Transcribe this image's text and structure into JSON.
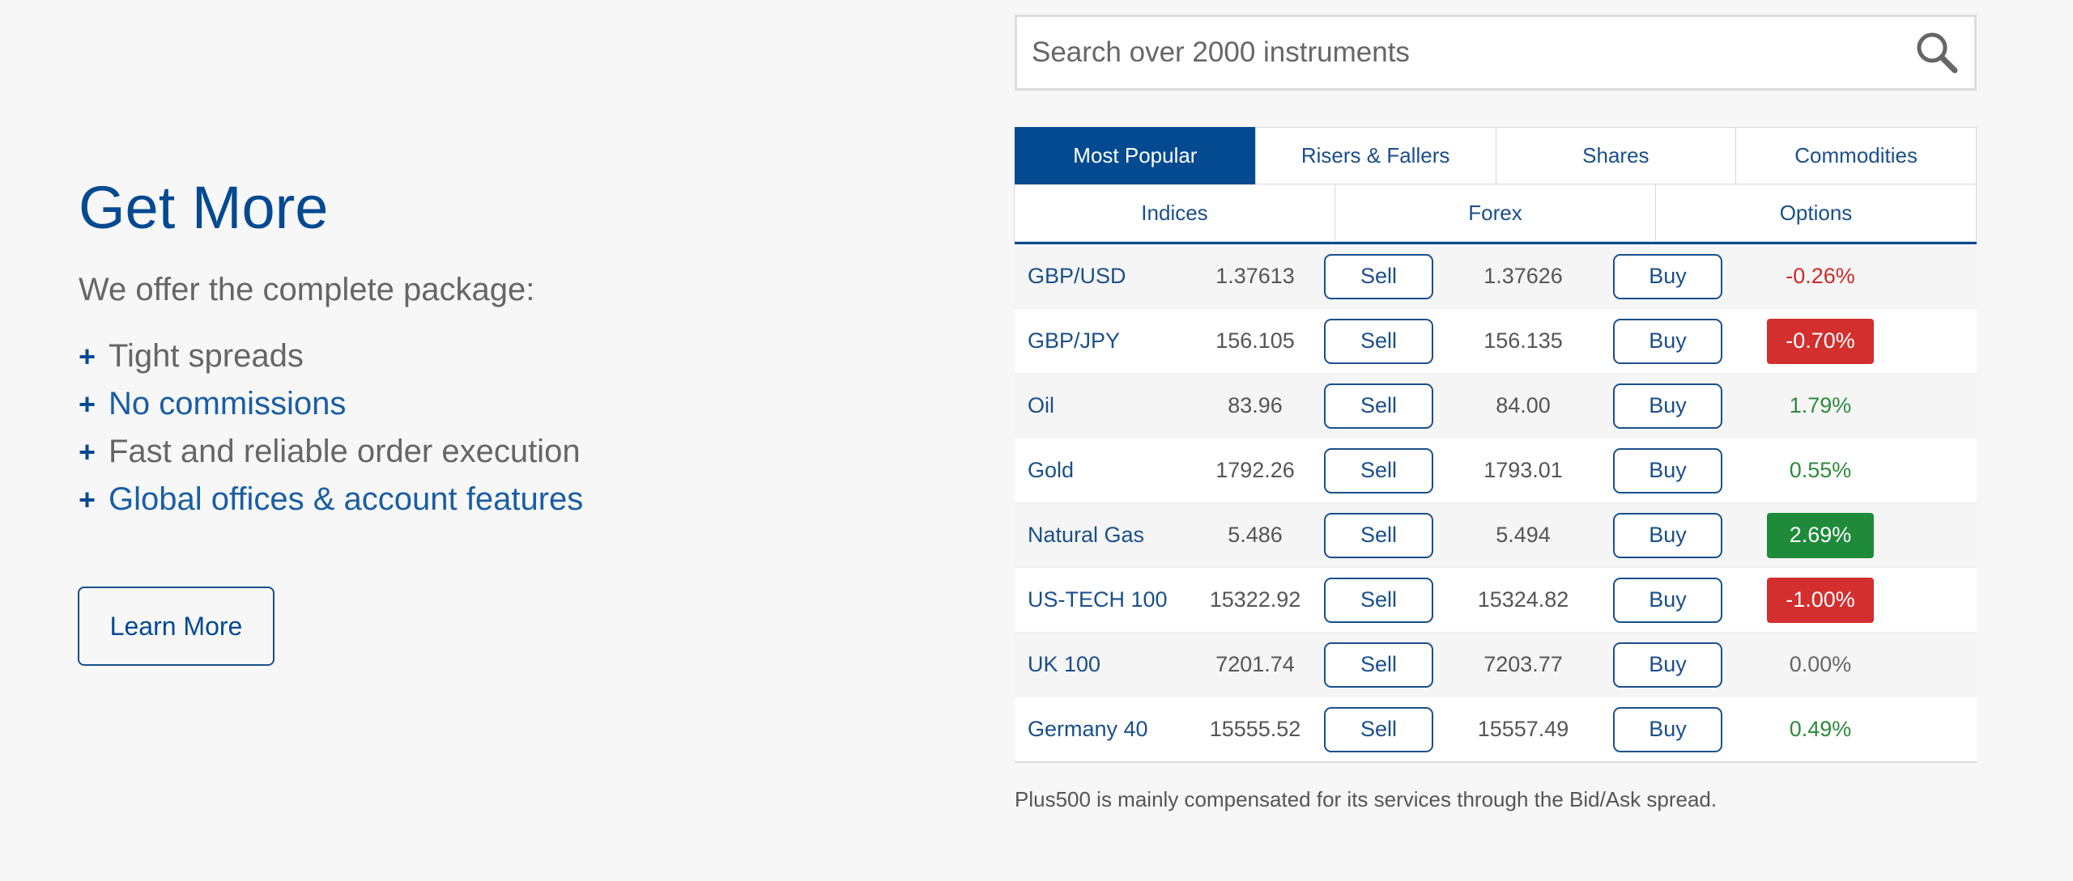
{
  "left": {
    "headline": "Get More",
    "subhead": "We offer the complete package:",
    "features": [
      "Tight spreads",
      "No commissions",
      "Fast and reliable order execution",
      "Global offices & account features"
    ],
    "learn_more": "Learn More"
  },
  "search": {
    "placeholder": "Search over 2000 instruments",
    "icon": "search-icon"
  },
  "tabs_row1": [
    "Most Popular",
    "Risers & Fallers",
    "Shares",
    "Commodities"
  ],
  "tabs_row2": [
    "Indices",
    "Forex",
    "Options"
  ],
  "active_tab": "Most Popular",
  "sell_label": "Sell",
  "buy_label": "Buy",
  "instruments": [
    {
      "name": "GBP/USD",
      "sell": "1.37613",
      "buy": "1.37626",
      "change": "-0.26%",
      "style": "neg"
    },
    {
      "name": "GBP/JPY",
      "sell": "156.105",
      "buy": "156.135",
      "change": "-0.70%",
      "style": "neg-box"
    },
    {
      "name": "Oil",
      "sell": "83.96",
      "buy": "84.00",
      "change": "1.79%",
      "style": "pos"
    },
    {
      "name": "Gold",
      "sell": "1792.26",
      "buy": "1793.01",
      "change": "0.55%",
      "style": "pos"
    },
    {
      "name": "Natural Gas",
      "sell": "5.486",
      "buy": "5.494",
      "change": "2.69%",
      "style": "pos-box"
    },
    {
      "name": "US-TECH 100",
      "sell": "15322.92",
      "buy": "15324.82",
      "change": "-1.00%",
      "style": "neg-box"
    },
    {
      "name": "UK 100",
      "sell": "7201.74",
      "buy": "7203.77",
      "change": "0.00%",
      "style": "zero"
    },
    {
      "name": "Germany 40",
      "sell": "15555.52",
      "buy": "15557.49",
      "change": "0.49%",
      "style": "pos"
    }
  ],
  "disclaimer": "Plus500 is mainly compensated for its services through the Bid/Ask spread.",
  "colors": {
    "brand_blue": "#044a91",
    "negative_red": "#d32f2f",
    "positive_green": "#1f8a3a"
  }
}
